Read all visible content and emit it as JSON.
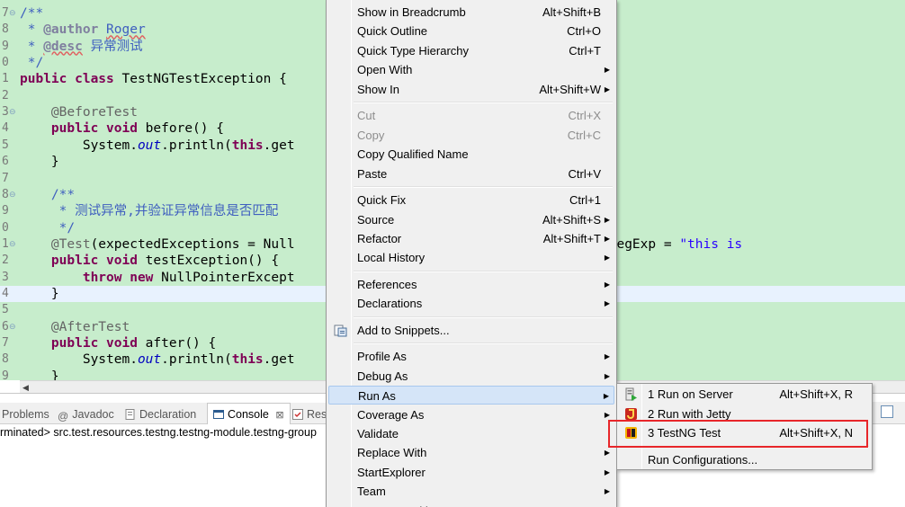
{
  "editor": {
    "lines": [
      {
        "num": "7",
        "fold": "⊖",
        "html": "<span class=\"cm\">/**</span>"
      },
      {
        "num": "8",
        "fold": "",
        "html": "<span class=\"cm\"> * </span><span class=\"tg\">@author</span><span class=\"cm\"> <span class=\"rsq\">Roger</span></span>"
      },
      {
        "num": "9",
        "fold": "",
        "html": "<span class=\"cm\"> * </span><span class=\"tg\"><span class=\"rsq\">@desc</span></span><span class=\"cm\"> 异常测试</span>"
      },
      {
        "num": "0",
        "fold": "",
        "html": "<span class=\"cm\"> */</span>"
      },
      {
        "num": "1",
        "fold": "",
        "html": "<span class=\"kw\">public class</span> TestNGTestException {"
      },
      {
        "num": "2",
        "fold": "",
        "html": ""
      },
      {
        "num": "3",
        "fold": "⊖",
        "html": "    <span class=\"an\">@BeforeTest</span>"
      },
      {
        "num": "4",
        "fold": "",
        "html": "    <span class=\"kw\">public void</span> before() {"
      },
      {
        "num": "5",
        "fold": "",
        "html": "        System.<span class=\"fd\">out</span>.println(<span class=\"kw\">this</span>.get"
      },
      {
        "num": "6",
        "fold": "",
        "html": "    }"
      },
      {
        "num": "7",
        "fold": "",
        "html": ""
      },
      {
        "num": "8",
        "fold": "⊖",
        "html": "    <span class=\"cm\">/**</span>"
      },
      {
        "num": "9",
        "fold": "",
        "html": "<span class=\"cm\">     * 测试异常,并验证异常信息是否匹配</span>"
      },
      {
        "num": "0",
        "fold": "",
        "html": "<span class=\"cm\">     */</span>"
      },
      {
        "num": "1",
        "fold": "⊖",
        "html": "    <span class=\"an\">@Test</span>(expectedExceptions = Null                        xceptionsMessageRegExp = <span class=\"st\">\"this is</span>"
      },
      {
        "num": "2",
        "fold": "",
        "html": "    <span class=\"kw\">public void</span> testException() {"
      },
      {
        "num": "3",
        "fold": "",
        "html": "        <span class=\"kw\">throw new</span> NullPointerExcept"
      },
      {
        "num": "4",
        "fold": "",
        "html": "    }"
      },
      {
        "num": "5",
        "fold": "",
        "html": ""
      },
      {
        "num": "6",
        "fold": "⊖",
        "html": "    <span class=\"an\">@AfterTest</span>"
      },
      {
        "num": "7",
        "fold": "",
        "html": "    <span class=\"kw\">public void</span> after() {"
      },
      {
        "num": "8",
        "fold": "",
        "html": "        System.<span class=\"fd\">out</span>.println(<span class=\"kw\">this</span>.get"
      },
      {
        "num": "9",
        "fold": "",
        "html": "    }"
      }
    ],
    "highlighted_line_index": 17
  },
  "panel": {
    "tabs": [
      {
        "id": "problems",
        "label": "Problems",
        "icon": "problems-icon"
      },
      {
        "id": "javadoc",
        "label": "Javadoc",
        "icon": "javadoc-icon"
      },
      {
        "id": "declaration",
        "label": "Declaration",
        "icon": "declaration-icon"
      },
      {
        "id": "console",
        "label": "Console",
        "icon": "console-icon"
      },
      {
        "id": "res",
        "label": "Res",
        "icon": "results-icon"
      }
    ],
    "status_text": "rminated> src.test.resources.testng.testng-module.testng-group"
  },
  "context_menu": {
    "items": [
      {
        "label": "Show in Breadcrumb",
        "accel": "Alt+Shift+B"
      },
      {
        "label": "Quick Outline",
        "accel": "Ctrl+O"
      },
      {
        "label": "Quick Type Hierarchy",
        "accel": "Ctrl+T"
      },
      {
        "label": "Open With",
        "accel": "",
        "submenu": true
      },
      {
        "label": "Show In",
        "accel": "Alt+Shift+W",
        "submenu": true
      },
      {
        "separator": true
      },
      {
        "label": "Cut",
        "accel": "Ctrl+X",
        "disabled": true
      },
      {
        "label": "Copy",
        "accel": "Ctrl+C",
        "disabled": true
      },
      {
        "label": "Copy Qualified Name",
        "accel": ""
      },
      {
        "label": "Paste",
        "accel": "Ctrl+V"
      },
      {
        "separator": true
      },
      {
        "label": "Quick Fix",
        "accel": "Ctrl+1"
      },
      {
        "label": "Source",
        "accel": "Alt+Shift+S",
        "submenu": true
      },
      {
        "label": "Refactor",
        "accel": "Alt+Shift+T",
        "submenu": true
      },
      {
        "label": "Local History",
        "accel": "",
        "submenu": true
      },
      {
        "separator": true
      },
      {
        "label": "References",
        "accel": "",
        "submenu": true
      },
      {
        "label": "Declarations",
        "accel": "",
        "submenu": true
      },
      {
        "separator": true
      },
      {
        "label": "Add to Snippets...",
        "accel": "",
        "icon": "snippets-icon"
      },
      {
        "separator": true
      },
      {
        "label": "Profile As",
        "accel": "",
        "submenu": true
      },
      {
        "label": "Debug As",
        "accel": "",
        "submenu": true
      },
      {
        "label": "Run As",
        "accel": "",
        "submenu": true,
        "selected": true
      },
      {
        "label": "Coverage As",
        "accel": "",
        "submenu": true
      },
      {
        "label": "Validate",
        "accel": ""
      },
      {
        "label": "Replace With",
        "accel": "",
        "submenu": true
      },
      {
        "label": "StartExplorer",
        "accel": "",
        "submenu": true
      },
      {
        "label": "Team",
        "accel": "",
        "submenu": true
      },
      {
        "label": "Compare With",
        "accel": "",
        "submenu": true
      }
    ]
  },
  "run_as_submenu": {
    "items": [
      {
        "label": "1 Run on Server",
        "accel": "Alt+Shift+X, R",
        "icon": "run-on-server-icon"
      },
      {
        "label": "2 Run with Jetty",
        "accel": "",
        "icon": "jetty-icon"
      },
      {
        "label": "3 TestNG Test",
        "accel": "Alt+Shift+X, N",
        "icon": "testng-icon",
        "highlighted": true
      },
      {
        "separator": true
      },
      {
        "label": "Run Configurations...",
        "accel": ""
      }
    ]
  },
  "colors": {
    "editor_bg": "#c7edcc",
    "menu_bg": "#f0f0f0",
    "highlight_box": "#e8262a",
    "selected_item": "#d5e5f8"
  }
}
